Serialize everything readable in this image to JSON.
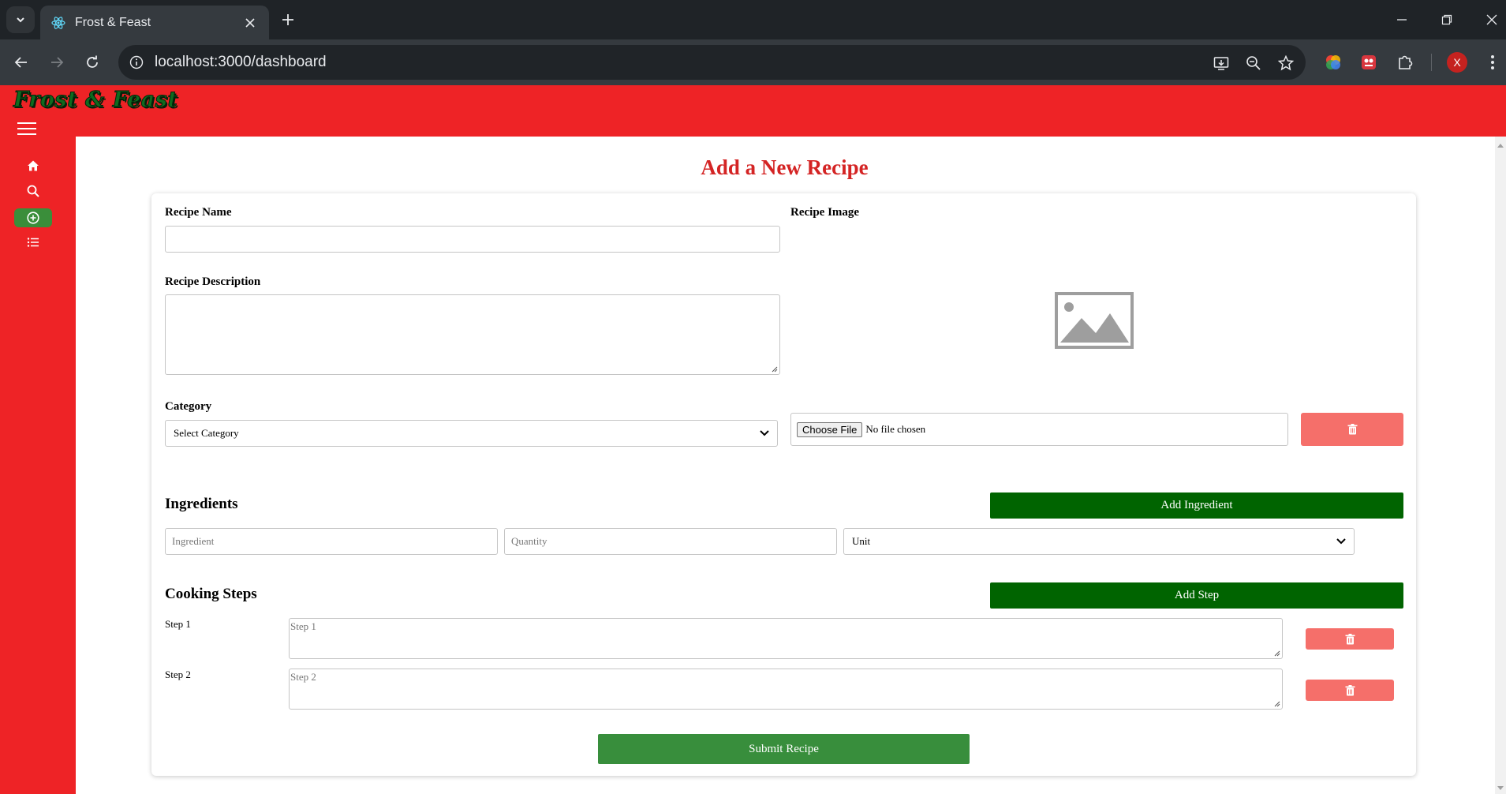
{
  "browser": {
    "tab_title": "Frost & Feast",
    "url": "localhost:3000/dashboard",
    "profile_initial": "X"
  },
  "app": {
    "logo": "Frost & Feast",
    "accent_color": "#ee2326",
    "sidebar": [
      {
        "icon": "home-icon",
        "active": false
      },
      {
        "icon": "search-icon",
        "active": false
      },
      {
        "icon": "plus-circle-icon",
        "active": true
      },
      {
        "icon": "list-icon",
        "active": false
      }
    ]
  },
  "form": {
    "title": "Add a New Recipe",
    "recipe_name_label": "Recipe Name",
    "recipe_name_value": "",
    "recipe_description_label": "Recipe Description",
    "recipe_image_label": "Recipe Image",
    "category_label": "Category",
    "category_selected": "Select Category",
    "choose_file_label": "Choose File",
    "no_file_text": "No file chosen",
    "ingredients_title": "Ingredients",
    "add_ingredient_label": "Add Ingredient",
    "ingredient_placeholder": "Ingredient",
    "quantity_placeholder": "Quantity",
    "unit_selected": "Unit",
    "cooking_steps_title": "Cooking Steps",
    "add_step_label": "Add Step",
    "steps": [
      {
        "label": "Step 1",
        "placeholder": "Step 1"
      },
      {
        "label": "Step 2",
        "placeholder": "Step 2"
      }
    ],
    "submit_label": "Submit Recipe"
  }
}
